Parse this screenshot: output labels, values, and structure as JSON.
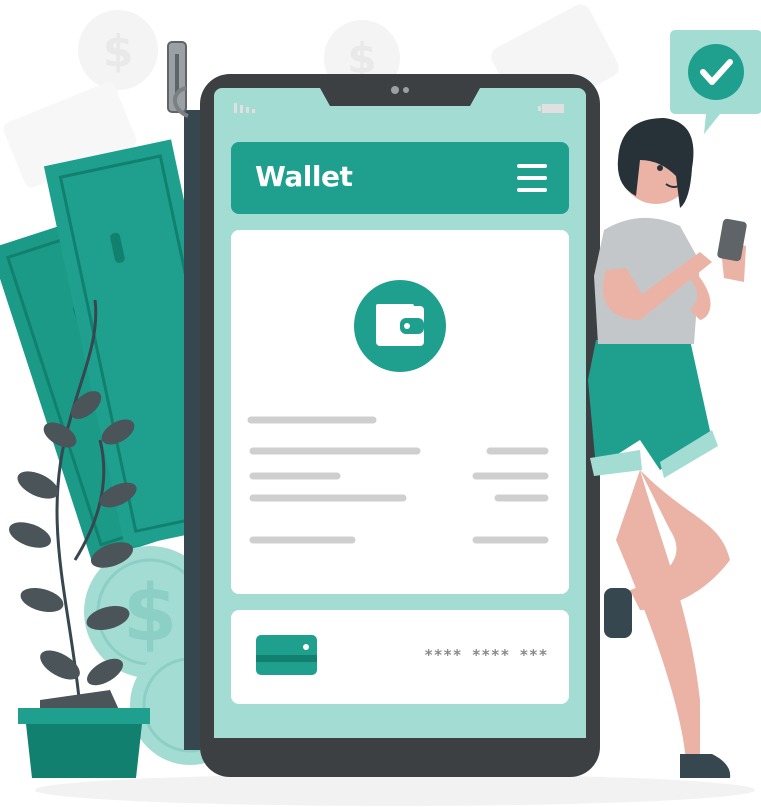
{
  "app": {
    "title": "Wallet",
    "menu_icon": "hamburger-menu-icon",
    "wallet_icon": "wallet-icon"
  },
  "card": {
    "masked_number": "**** **** ***",
    "icon": "credit-card-icon"
  },
  "colors": {
    "accent": "#1fa08e",
    "accent_dark": "#12806f",
    "mint": "#a3dcd3",
    "phone_frame": "#3c4043",
    "skin": "#eab3a6"
  }
}
